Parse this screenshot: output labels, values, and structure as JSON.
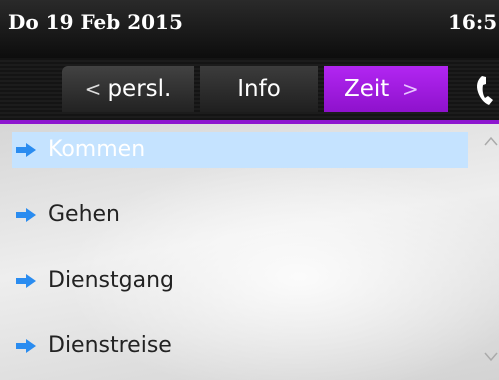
{
  "status": {
    "date": "Do 19 Feb 2015",
    "time": "16:5"
  },
  "tabs": [
    {
      "label": "persl.",
      "chevron": "<",
      "state": "inactive"
    },
    {
      "label": "Info",
      "state": "inactive"
    },
    {
      "label": "Zeit",
      "chevron": ">",
      "state": "active"
    }
  ],
  "call_icon": "phone-icon",
  "list": {
    "items": [
      {
        "label": "Kommen",
        "selected": true
      },
      {
        "label": "Gehen",
        "selected": false
      },
      {
        "label": "Dienstgang",
        "selected": false
      },
      {
        "label": "Dienstreise",
        "selected": false
      }
    ]
  },
  "colors": {
    "accent_purple": "#a020e6",
    "selected_row": "#c5e3ff",
    "bullet_blue": "#2a8cf0"
  }
}
